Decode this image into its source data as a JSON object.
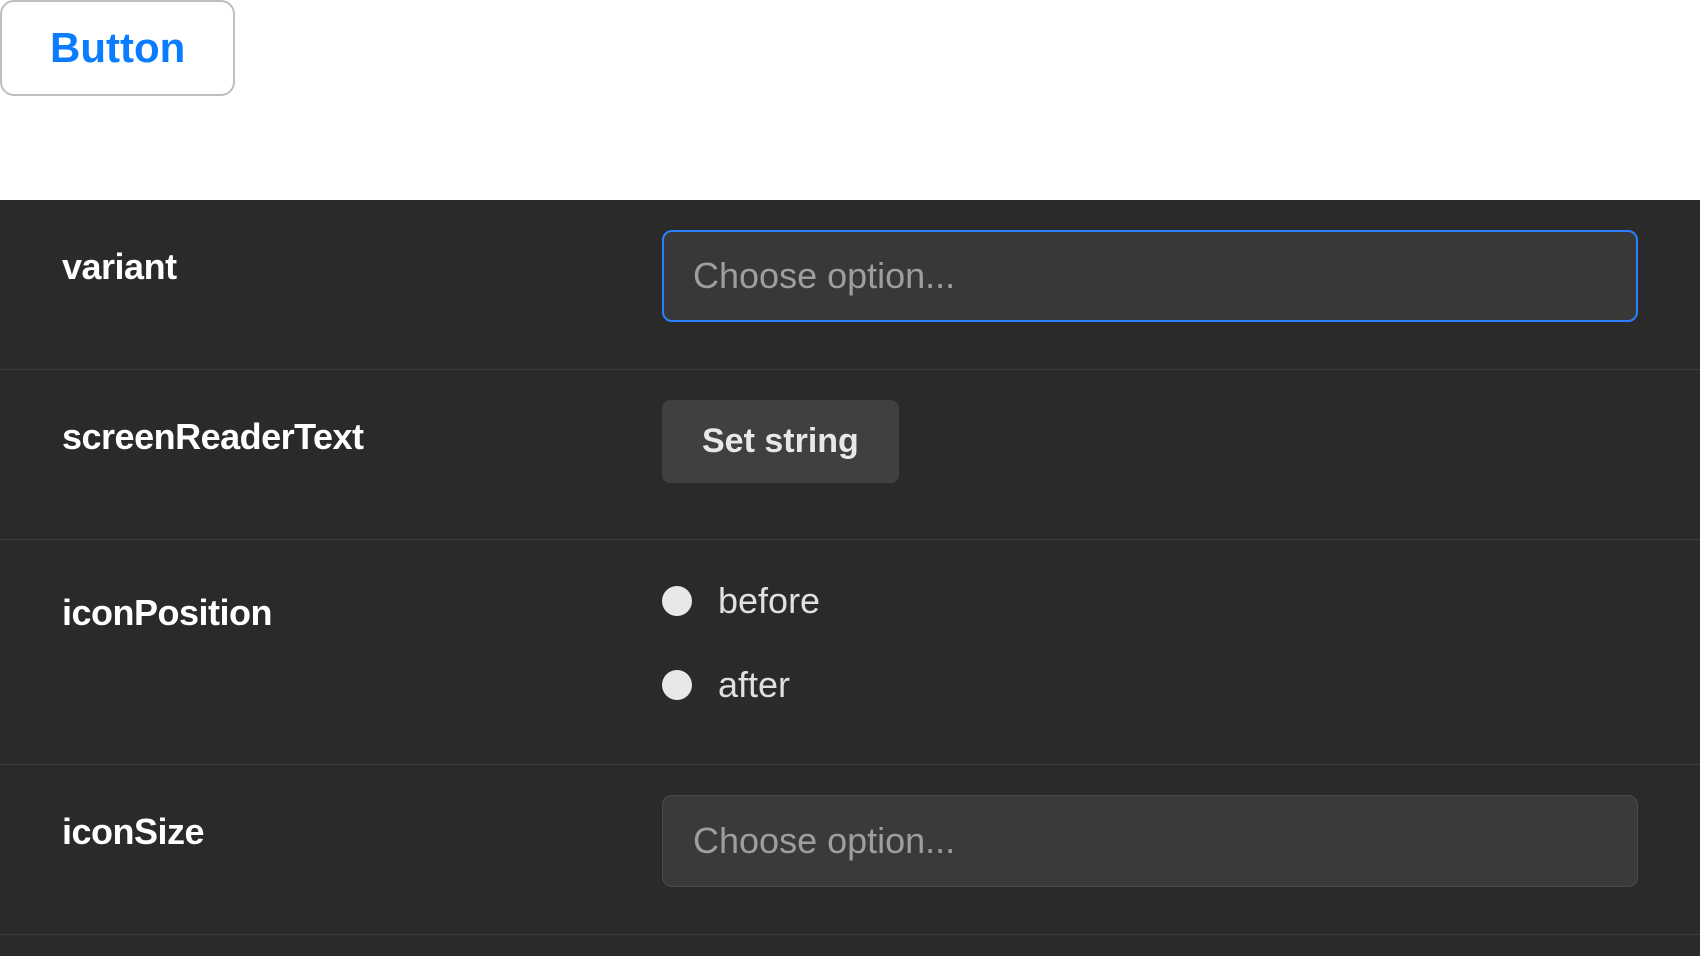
{
  "preview": {
    "button_label": "Button"
  },
  "controls": {
    "variant": {
      "label": "variant",
      "placeholder": "Choose option..."
    },
    "screenReaderText": {
      "label": "screenReaderText",
      "button_label": "Set string"
    },
    "iconPosition": {
      "label": "iconPosition",
      "options": [
        {
          "label": "before"
        },
        {
          "label": "after"
        }
      ]
    },
    "iconSize": {
      "label": "iconSize",
      "placeholder": "Choose option..."
    }
  }
}
